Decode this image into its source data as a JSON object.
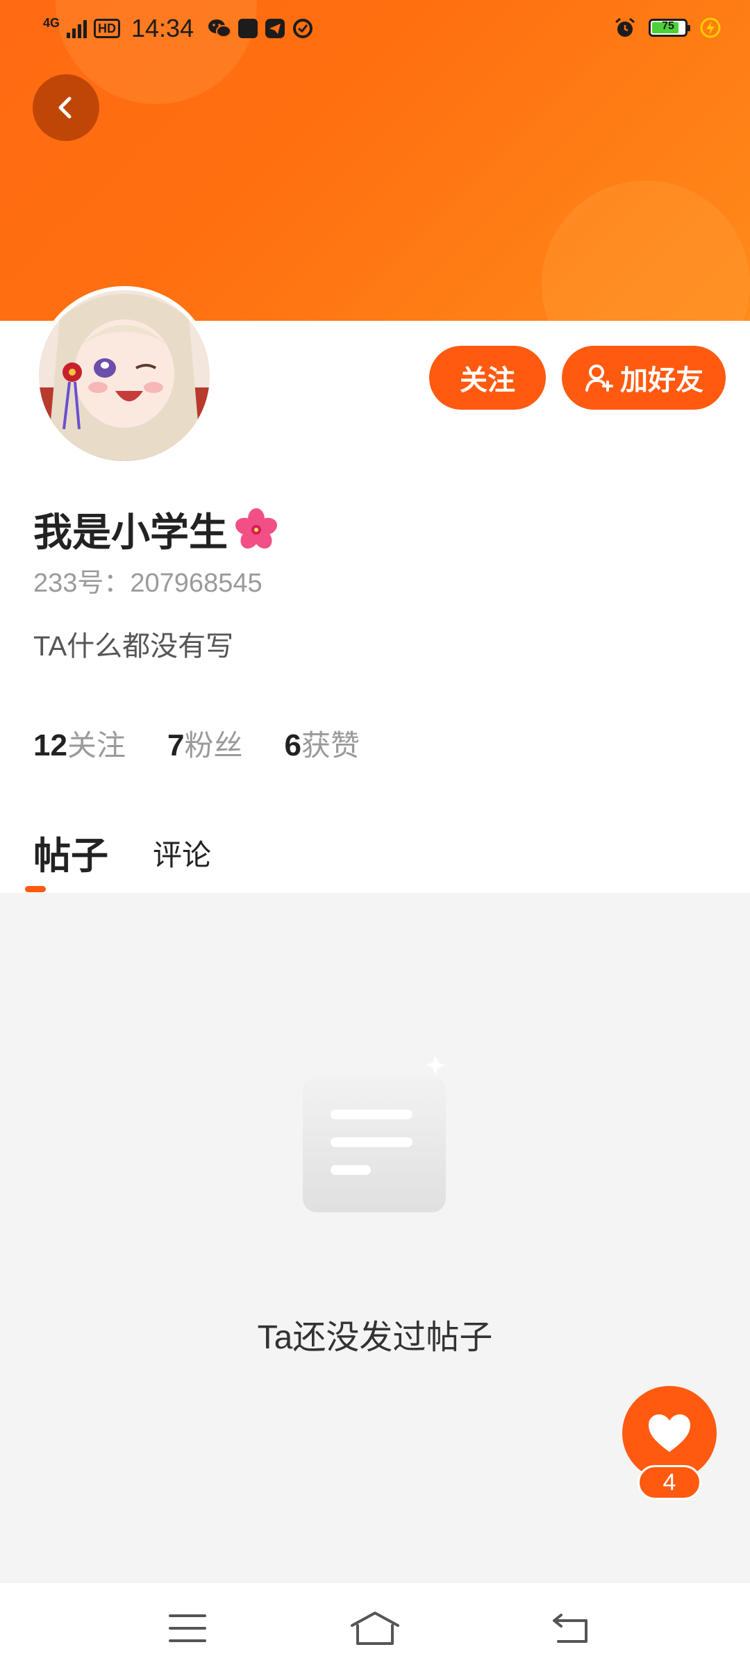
{
  "status_bar": {
    "network": "4G",
    "hd": "HD",
    "time": "14:34",
    "battery_level": "75",
    "icons": [
      "signal-icon",
      "hd-icon",
      "wechat-icon",
      "app-icon",
      "telegram-icon",
      "check-circle-icon",
      "alarm-icon",
      "battery-icon",
      "charging-icon"
    ]
  },
  "header": {
    "back_icon": "chevron-left-icon",
    "colors": {
      "primary": "#ff6a12",
      "accent": "#ff5a10"
    }
  },
  "profile": {
    "username": "我是小学生",
    "username_emoji": "hibiscus-icon",
    "id_text": "233号：207968545",
    "bio": "TA什么都没有写"
  },
  "actions": {
    "follow_label": "关注",
    "add_friend_label": "加好友",
    "add_friend_icon": "user-plus-icon"
  },
  "stats": [
    {
      "num": "12",
      "label": "关注"
    },
    {
      "num": "7",
      "label": "粉丝"
    },
    {
      "num": "6",
      "label": "获赞"
    }
  ],
  "tabs": {
    "posts": "帖子",
    "comments": "评论",
    "active": "posts"
  },
  "content": {
    "empty_text": "Ta还没发过帖子",
    "empty_icon": "document-icon"
  },
  "fab": {
    "icon": "heart-icon",
    "count": "4"
  },
  "nav": {
    "icons": [
      "menu-icon",
      "home-icon",
      "back-icon"
    ]
  }
}
